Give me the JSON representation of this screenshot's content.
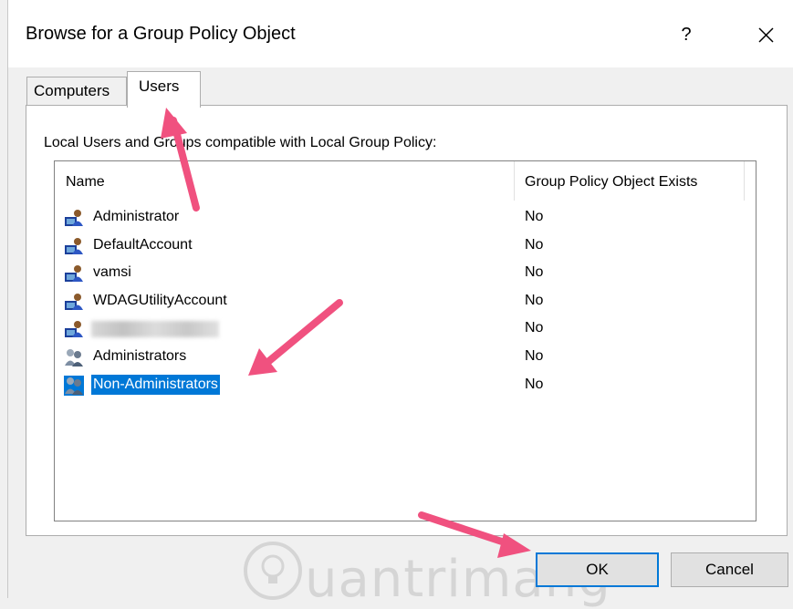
{
  "window": {
    "title": "Browse for a Group Policy Object",
    "help_label": "?"
  },
  "tabs": [
    {
      "label": "Computers",
      "selected": false
    },
    {
      "label": "Users",
      "selected": true
    }
  ],
  "panel": {
    "description": "Local Users and Groups compatible with Local Group Policy:"
  },
  "list": {
    "columns": [
      "Name",
      "Group Policy Object Exists"
    ],
    "rows": [
      {
        "name": "Administrator",
        "exists": "No",
        "icon": "user-icon"
      },
      {
        "name": "DefaultAccount",
        "exists": "No",
        "icon": "user-icon"
      },
      {
        "name": "vamsi",
        "exists": "No",
        "icon": "user-icon"
      },
      {
        "name": "WDAGUtilityAccount",
        "exists": "No",
        "icon": "user-icon"
      },
      {
        "name": "",
        "exists": "No",
        "icon": "user-icon",
        "redacted": true
      },
      {
        "name": "Administrators",
        "exists": "No",
        "icon": "group-icon"
      },
      {
        "name": "Non-Administrators",
        "exists": "No",
        "icon": "group-icon",
        "selected": true
      }
    ]
  },
  "buttons": {
    "ok": "OK",
    "cancel": "Cancel"
  },
  "watermark": {
    "text": "uantrimang"
  },
  "colors": {
    "selection": "#0078d7",
    "annotation_arrow": "#f0517f"
  }
}
